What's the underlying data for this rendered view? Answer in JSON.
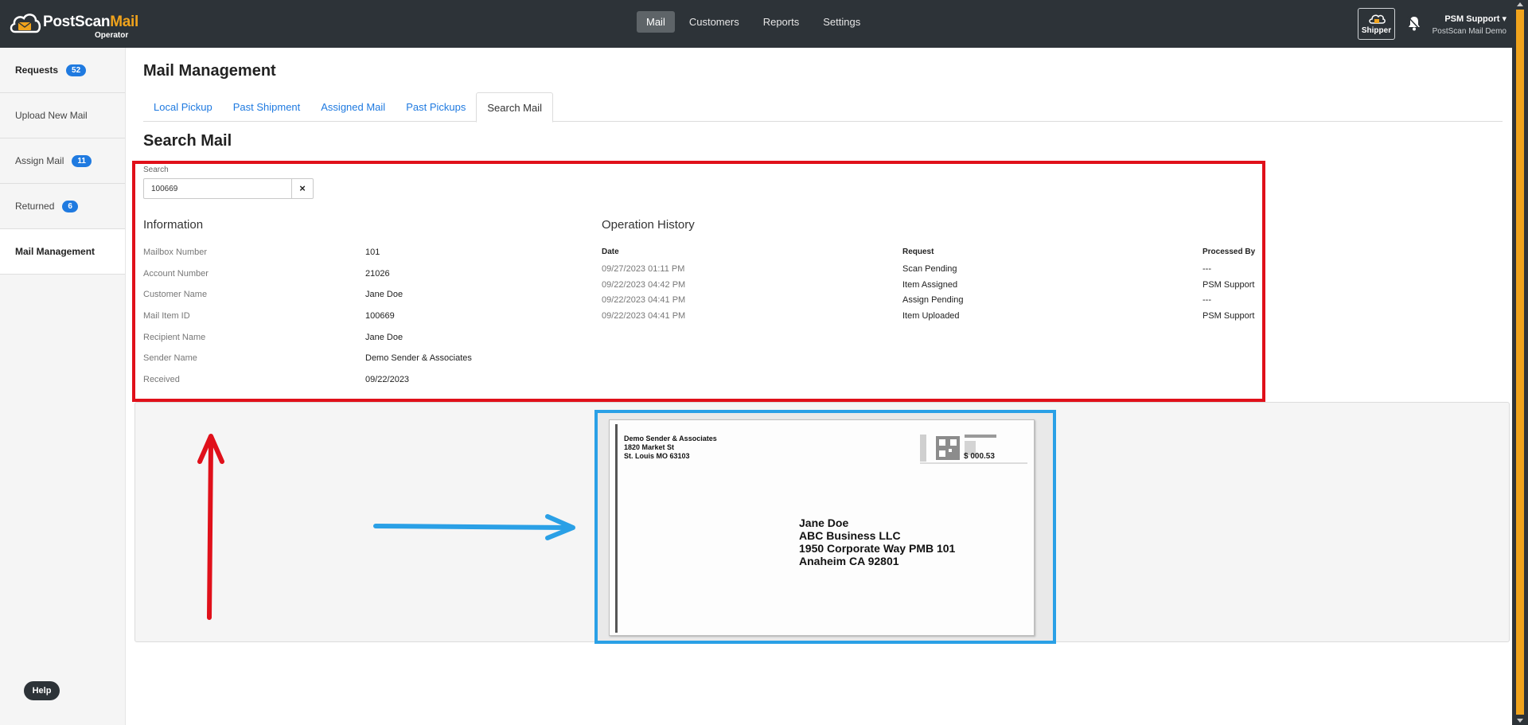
{
  "app": {
    "logo_part1": "PostScan",
    "logo_part2": "Mail",
    "logo_sub": "Operator"
  },
  "nav": {
    "items": [
      {
        "label": "Mail",
        "active": true
      },
      {
        "label": "Customers",
        "active": false
      },
      {
        "label": "Reports",
        "active": false
      },
      {
        "label": "Settings",
        "active": false
      }
    ]
  },
  "header": {
    "shipper_label": "Shipper",
    "user_name": "PSM Support",
    "user_org": "PostScan Mail Demo"
  },
  "sidebar": {
    "items": [
      {
        "label": "Requests",
        "badge": "52"
      },
      {
        "label": "Upload New Mail",
        "badge": ""
      },
      {
        "label": "Assign Mail",
        "badge": "11"
      },
      {
        "label": "Returned",
        "badge": "6"
      },
      {
        "label": "Mail Management",
        "badge": ""
      }
    ],
    "help_label": "Help"
  },
  "main": {
    "title": "Mail Management",
    "tabs": [
      {
        "label": "Local Pickup"
      },
      {
        "label": "Past Shipment"
      },
      {
        "label": "Assigned Mail"
      },
      {
        "label": "Past Pickups"
      },
      {
        "label": "Search Mail"
      }
    ],
    "section_title": "Search Mail",
    "search": {
      "label": "Search",
      "value": "100669",
      "clear_label": "×"
    },
    "information": {
      "title": "Information",
      "rows": [
        {
          "key": "Mailbox Number",
          "value": "101"
        },
        {
          "key": "Account Number",
          "value": "21026"
        },
        {
          "key": "Customer Name",
          "value": "Jane Doe"
        },
        {
          "key": "Mail Item ID",
          "value": "100669"
        },
        {
          "key": "Recipient Name",
          "value": "Jane Doe"
        },
        {
          "key": "Sender Name",
          "value": "Demo Sender & Associates"
        },
        {
          "key": "Received",
          "value": "09/22/2023"
        }
      ]
    },
    "history": {
      "title": "Operation History",
      "headers": [
        "Date",
        "Request",
        "Processed By"
      ],
      "rows": [
        [
          "09/27/2023 01:11 PM",
          "Scan Pending",
          "---"
        ],
        [
          "09/22/2023 04:42 PM",
          "Item Assigned",
          "PSM Support"
        ],
        [
          "09/22/2023 04:41 PM",
          "Assign Pending",
          "---"
        ],
        [
          "09/22/2023 04:41 PM",
          "Item Uploaded",
          "PSM Support"
        ]
      ]
    },
    "envelope": {
      "sender_lines": [
        "Demo Sender & Associates",
        "1820 Market St",
        "St. Louis MO 63103"
      ],
      "recipient_lines": [
        "Jane Doe",
        "ABC Business LLC",
        "1950 Corporate Way PMB 101",
        "Anaheim CA 92801"
      ],
      "postage": "$ 000.53"
    }
  },
  "colors": {
    "topbar": "#2d3338",
    "accent": "#1f7ae0",
    "brand_orange": "#f0a31c",
    "highlight_red": "#e0101a",
    "highlight_blue": "#2aa0e6"
  }
}
